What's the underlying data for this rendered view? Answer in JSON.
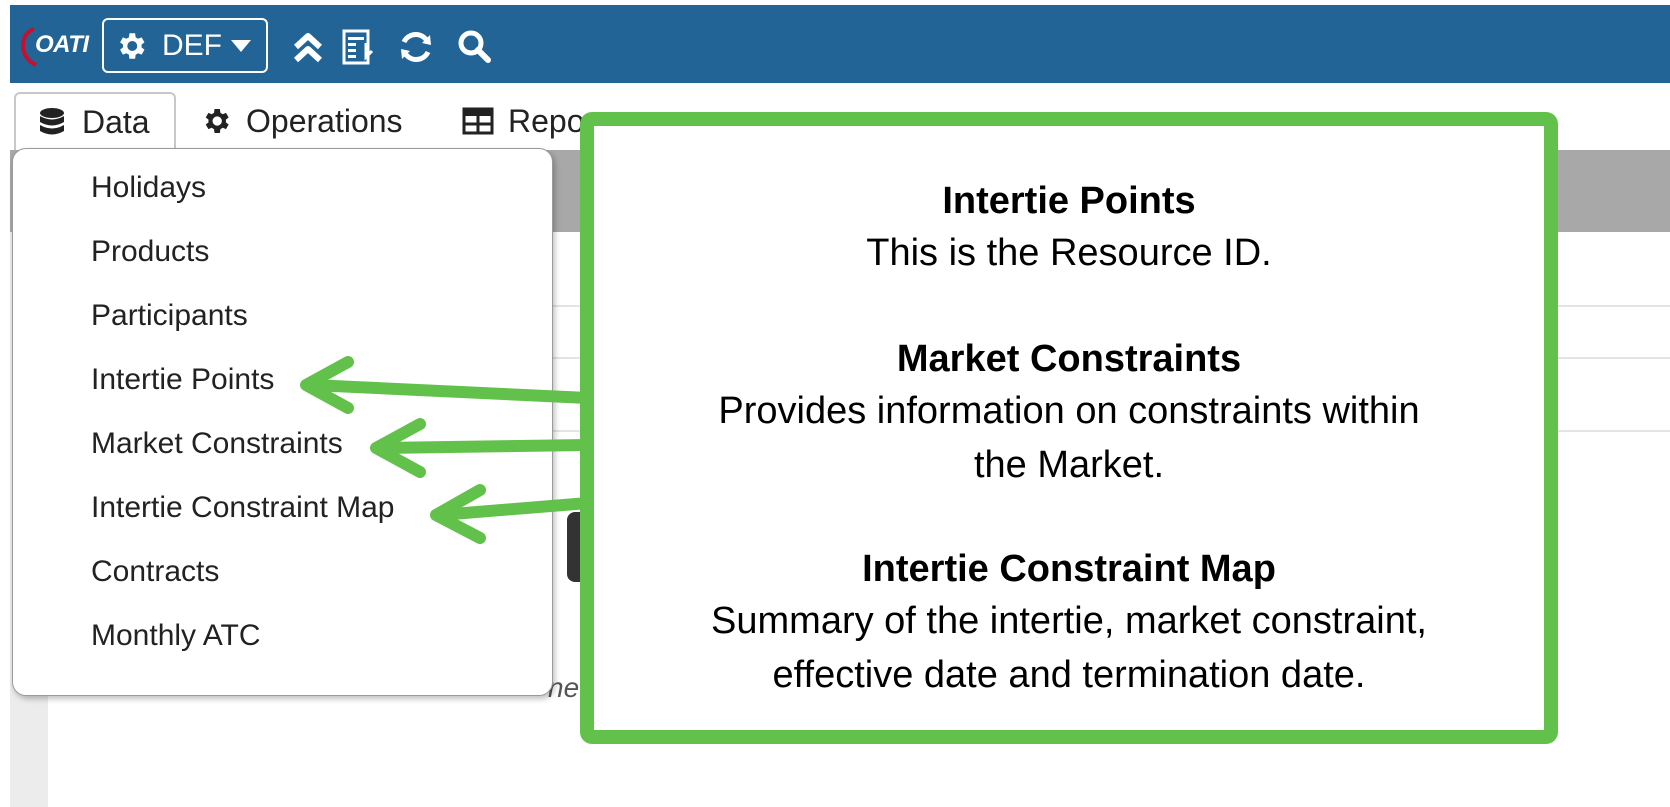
{
  "topbar": {
    "logo_text": "OATI",
    "env_label": "DEF",
    "icons": [
      "gear-icon",
      "caret-down-icon",
      "collapse-up-icon",
      "report-icon",
      "refresh-icon",
      "search-icon"
    ],
    "color": "#226496"
  },
  "nav": {
    "tabs": [
      {
        "label": "Data",
        "icon": "database-icon"
      },
      {
        "label": "Operations",
        "icon": "gear-icon"
      },
      {
        "label": "Repo",
        "icon": "table-icon"
      }
    ]
  },
  "dropdown": {
    "items": [
      "Holidays",
      "Products",
      "Participants",
      "Intertie Points",
      "Market Constraints",
      "Intertie Constraint Map",
      "Contracts",
      "Monthly ATC"
    ]
  },
  "background": {
    "italic_text": "ne"
  },
  "callout": {
    "accent_color": "#62c14a",
    "sections": [
      {
        "title": "Intertie Points",
        "desc": [
          "This is the Resource ID."
        ]
      },
      {
        "title": "Market Constraints",
        "desc": [
          "Provides information on constraints within",
          "the Market."
        ]
      },
      {
        "title": "Intertie Constraint Map",
        "desc": [
          "Summary of the intertie, market constraint,",
          "effective date and termination date."
        ]
      }
    ]
  }
}
